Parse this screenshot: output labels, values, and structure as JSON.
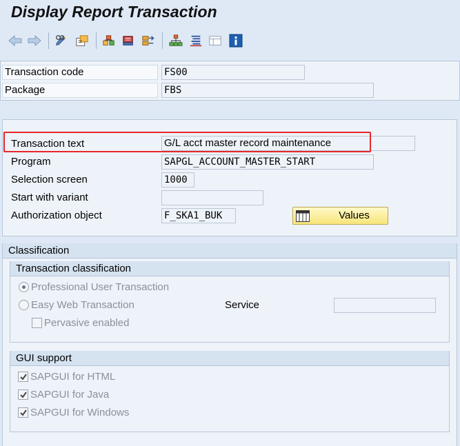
{
  "window": {
    "title": "Display Report Transaction"
  },
  "toolbar": {
    "icons": [
      "back-arrow-icon",
      "forward-arrow-icon",
      "display-change-icon",
      "other-object-icon",
      "where-used-icon",
      "transport-icon",
      "object-list-icon",
      "hierarchy-icon",
      "navigation-list-icon",
      "layout-icon",
      "info-icon"
    ]
  },
  "header": {
    "transaction_code": {
      "label": "Transaction code",
      "value": "FS00"
    },
    "package": {
      "label": "Package",
      "value": "FBS"
    }
  },
  "details": {
    "transaction_text": {
      "label": "Transaction text",
      "value": "G/L acct master record maintenance"
    },
    "program": {
      "label": "Program",
      "value": "SAPGL_ACCOUNT_MASTER_START"
    },
    "selection_screen": {
      "label": "Selection screen",
      "value": "1000"
    },
    "start_with_variant": {
      "label": "Start with variant",
      "value": ""
    },
    "authorization_object": {
      "label": "Authorization object",
      "value": "F_SKA1_BUK"
    },
    "values_button": "Values"
  },
  "classification": {
    "title": "Classification",
    "transaction_classification": {
      "title": "Transaction classification",
      "professional_user": "Professional User Transaction",
      "easy_web": "Easy Web Transaction",
      "service_label": "Service",
      "service_value": "",
      "pervasive": "Pervasive enabled",
      "selected": "professional_user"
    },
    "gui_support": {
      "title": "GUI support",
      "html": "SAPGUI for HTML",
      "java": "SAPGUI for Java",
      "windows": "SAPGUI for Windows"
    }
  },
  "colors": {
    "highlight": "#e8262a",
    "values_button": "#f8e57a"
  }
}
